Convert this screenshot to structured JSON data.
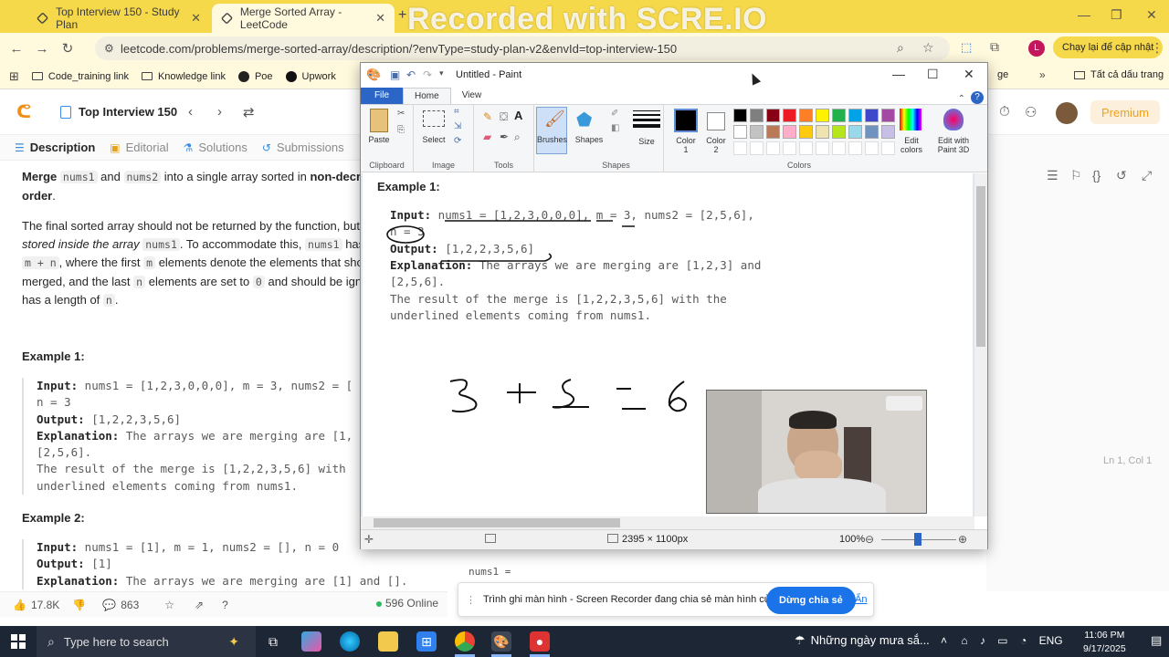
{
  "browser": {
    "tabs": [
      {
        "title": "Top Interview 150 - Study Plan"
      },
      {
        "title": "Merge Sorted Array - LeetCode"
      }
    ],
    "new_tab": "+",
    "watermark": "Recorded with SCRE.IO",
    "url": "leetcode.com/problems/merge-sorted-array/description/?envType=study-plan-v2&envId=top-interview-150",
    "profile_initial": "L",
    "update_button": "Chạy lại để cập nhật",
    "bookmarks": [
      "Code_training link",
      "Knowledge link",
      "Poe",
      "Upwork"
    ],
    "bookmarks_more": "Tất cả dấu trang",
    "bookmark_partial": "ge"
  },
  "leetcode": {
    "study_plan": "Top Interview 150",
    "premium": "Premium",
    "tabs": [
      "Description",
      "Editorial",
      "Solutions",
      "Submissions"
    ],
    "desc_line1": "Merge",
    "desc_code1": "nums1",
    "desc_and": "and",
    "desc_code2": "nums2",
    "desc_rest1": "into a single array sorted in",
    "desc_bold1": "non-decre",
    "desc_bold2": "order",
    "desc_p2a": "The final sorted array should not be returned by the function, but",
    "desc_p2b": "stored inside the array",
    "desc_p2c": "To accommodate this,",
    "desc_p2d": "has a",
    "desc_p2e": "m + n",
    "desc_p2f": ", where the first",
    "desc_p2g": "m",
    "desc_p2h": "elements denote the elements that shou",
    "desc_p2i": "merged, and the last",
    "desc_p2j": "n",
    "desc_p2k": "elements are set to",
    "desc_p2l": "0",
    "desc_p2m": "and should be igno",
    "desc_p2n": "has a length of",
    "desc_p2o": "n",
    "example1_label": "Example 1:",
    "example1_lines": [
      [
        "Input:",
        " nums1 = [1,2,3,0,0,0], m = 3, nums2 = ["
      ],
      [
        "",
        "n = 3"
      ],
      [
        "Output:",
        " [1,2,2,3,5,6]"
      ],
      [
        "Explanation:",
        " The arrays we are merging are [1,"
      ],
      [
        "",
        "[2,5,6]."
      ],
      [
        "",
        "The result of the merge is [1,2,2,3,5,6] with"
      ],
      [
        "",
        "underlined elements coming from nums1."
      ]
    ],
    "example2_label": "Example 2:",
    "example2_lines": [
      [
        "Input:",
        " nums1 = [1], m = 1, nums2 = [], n = 0"
      ],
      [
        "Output:",
        " [1]"
      ],
      [
        "Explanation:",
        " The arrays we are merging are [1] and []."
      ]
    ],
    "likes": "17.8K",
    "comments": "863",
    "online": "596 Online",
    "lncol": "Ln 1, Col 1",
    "code_nums1": "nums1 ="
  },
  "paint": {
    "title": "Untitled - Paint",
    "tabs": [
      "File",
      "Home",
      "View"
    ],
    "groups": [
      "Clipboard",
      "Image",
      "Tools",
      "Shapes",
      "Colors"
    ],
    "buttons": {
      "paste": "Paste",
      "select": "Select",
      "brushes": "Brushes",
      "shapes": "Shapes",
      "size": "Size",
      "color1a": "Color",
      "color1b": "1",
      "color2a": "Color",
      "color2b": "2",
      "edit_colors_a": "Edit",
      "edit_colors_b": "colors",
      "paint3d_a": "Edit with",
      "paint3d_b": "Paint 3D"
    },
    "palette_row1": [
      "#000000",
      "#7f7f7f",
      "#880015",
      "#ed1c24",
      "#ff7f27",
      "#fff200",
      "#22b14c",
      "#00a2e8",
      "#3f48cc",
      "#a349a4"
    ],
    "palette_row2": [
      "#ffffff",
      "#c3c3c3",
      "#b97a57",
      "#ffaec9",
      "#ffc90e",
      "#efe4b0",
      "#b5e61d",
      "#99d9ea",
      "#7092be",
      "#c8bfe7"
    ],
    "canvas": {
      "example_label": "Example 1:",
      "lines": [
        [
          "Input:",
          " nums1 = [1,2,3,0,0,0], m = 3, nums2 = [2,5,6],"
        ],
        [
          "",
          "n = 3"
        ],
        [
          "Output:",
          " [1,2,2,3,5,6]"
        ],
        [
          "Explanation:",
          " The arrays we are merging are [1,2,3] and"
        ],
        [
          "",
          "[2,5,6]."
        ],
        [
          "",
          "The result of the merge is [1,2,2,3,5,6] with the"
        ],
        [
          "",
          "underlined elements coming from nums1."
        ]
      ],
      "handwriting": "3 + 3 = 6"
    },
    "status_size": "2395 × 1100px",
    "zoom": "100%"
  },
  "recorder": {
    "message": "Trình ghi màn hình - Screen Recorder đang chia sẻ màn hình của bạn.",
    "stop": "Dừng chia sẻ",
    "hide": "Ẩn"
  },
  "taskbar": {
    "search": "Type here to search",
    "weather": "Những ngày mưa sắ...",
    "lang": "ENG",
    "time": "11:06 PM",
    "date": "9/17/2025"
  }
}
